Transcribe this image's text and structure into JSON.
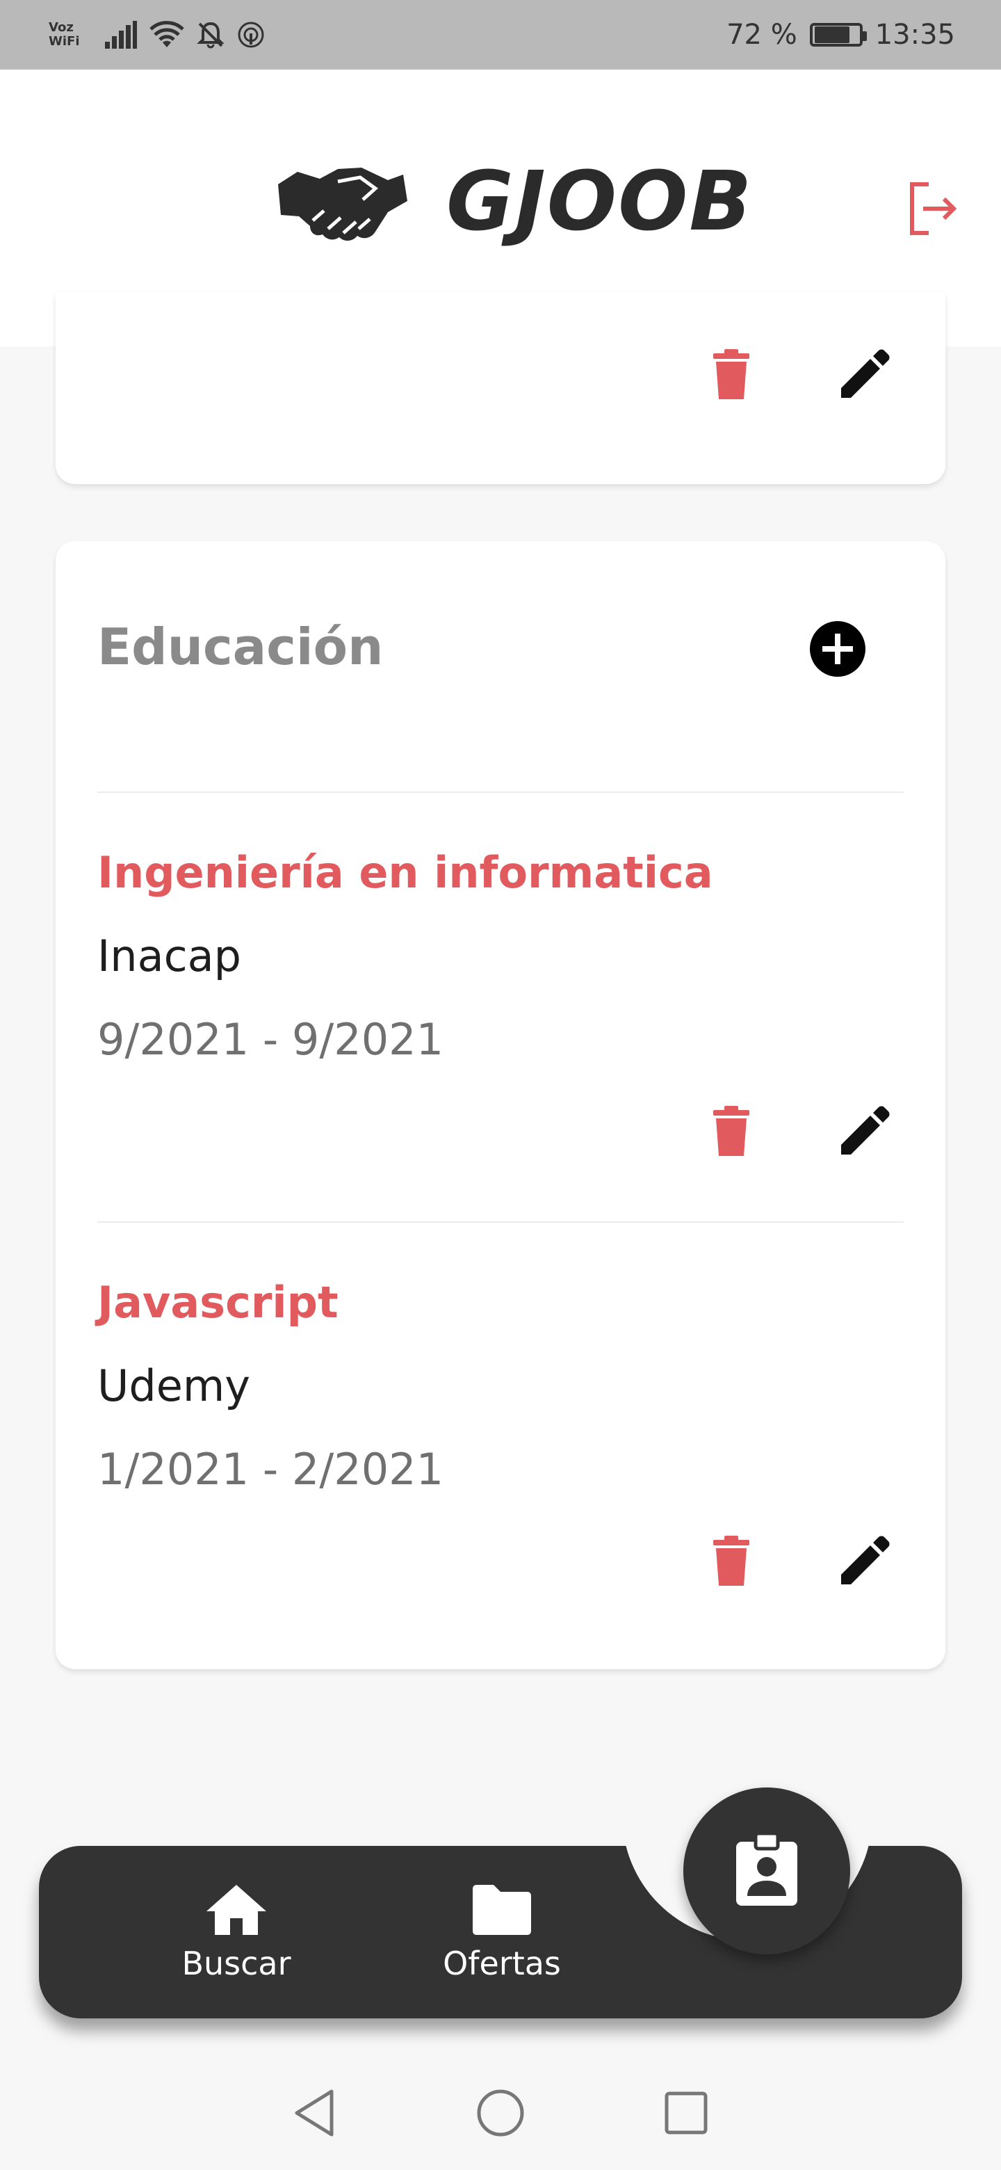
{
  "status_bar": {
    "carrier_line1": "Voz",
    "carrier_line2": "WiFi",
    "battery": "72 %",
    "time": "13:35",
    "icons": [
      "signal-icon",
      "wifi-icon",
      "bell-off-icon",
      "hotspot-icon",
      "battery-icon"
    ]
  },
  "header": {
    "app_name": "GJOOB",
    "logo_icon": "handshake-icon",
    "logout_icon": "logout-icon",
    "accent_color": "#e05a5e"
  },
  "top_card": {
    "delete_icon": "trash-icon",
    "edit_icon": "pencil-icon"
  },
  "education": {
    "title": "Educación",
    "add_icon": "plus-circle-icon",
    "entries": [
      {
        "degree": "Ingeniería en informatica",
        "institution": "Inacap",
        "dates": "9/2021 - 9/2021"
      },
      {
        "degree": "Javascript",
        "institution": "Udemy",
        "dates": "1/2021 - 2/2021"
      }
    ]
  },
  "bottom_nav": {
    "items": [
      {
        "label": "Buscar",
        "icon": "home-icon"
      },
      {
        "label": "Ofertas",
        "icon": "folder-icon"
      }
    ],
    "fab_icon": "profile-badge-icon"
  },
  "system_nav": {
    "icons": [
      "back-icon",
      "home-circle-icon",
      "recents-icon"
    ]
  }
}
